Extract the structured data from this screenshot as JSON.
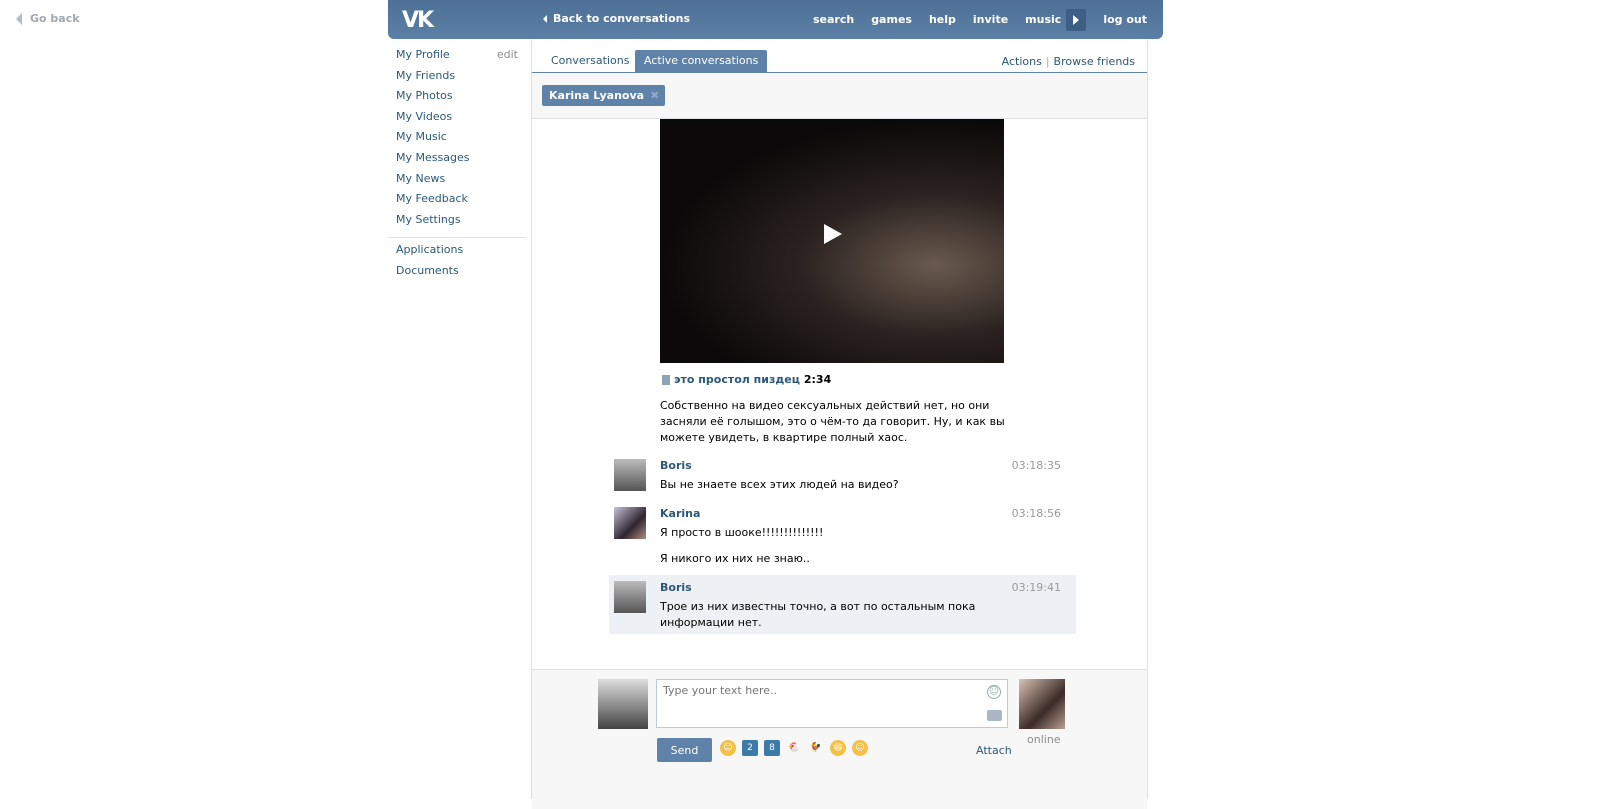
{
  "go_back": "Go back",
  "header": {
    "logo": "VK",
    "back": "Back to conversations",
    "nav": [
      "search",
      "games",
      "help",
      "invite",
      "music",
      "log out"
    ]
  },
  "sidebar": {
    "items": [
      "My Profile",
      "My Friends",
      "My Photos",
      "My Videos",
      "My Music",
      "My Messages",
      "My News",
      "My Feedback",
      "My Settings"
    ],
    "edit": "edit",
    "extra": [
      "Applications",
      "Documents"
    ]
  },
  "tabs": {
    "conversations": "Conversations",
    "active": "Active conversations",
    "actions": "Actions",
    "sep": "|",
    "browse": "Browse friends"
  },
  "peer": {
    "name": "Karina Lyanova",
    "close": "✖"
  },
  "video": {
    "title": "это простол пиздец",
    "duration": "2:34"
  },
  "description": "Собственно на видео сексуальных действий нет, но они засняли её голышом, это о чём-то да говорит. Ну, и как вы можете увидеть, в квартире полный хаос.",
  "messages": [
    {
      "name": "Boris",
      "time": "03:18:35",
      "text": "Вы не знаете всех этих людей на видео?"
    },
    {
      "name": "Karina",
      "time": "03:18:56",
      "text": "Я просто в шооке!!!!!!!!!!!!!!"
    },
    {
      "text": "Я никого их них не знаю.."
    },
    {
      "name": "Boris",
      "time": "03:19:41",
      "text": "Трое из них известны точно, а вот по остальным пока информации нет."
    }
  ],
  "compose": {
    "placeholder": "Type your text here..",
    "send": "Send",
    "attach": "Attach",
    "status": "online",
    "smile": "☺",
    "emoji": [
      "☺",
      "2",
      "8",
      "🐔",
      "🐓",
      "😄",
      "☺"
    ]
  }
}
